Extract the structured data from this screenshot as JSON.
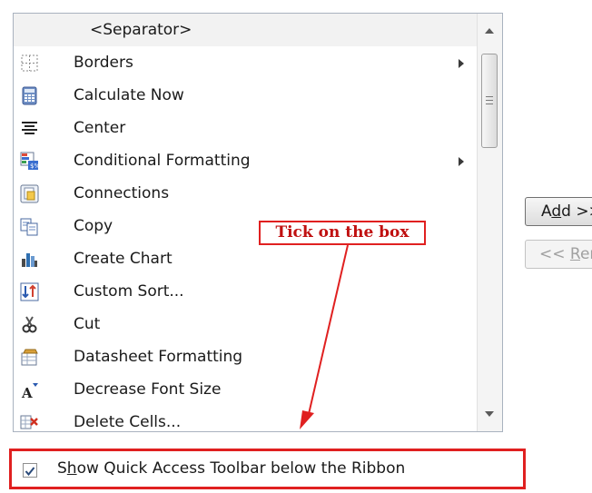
{
  "list": {
    "separator_label": "<Separator>",
    "items": [
      {
        "label": "Borders",
        "icon": "borders-icon",
        "submenu": true
      },
      {
        "label": "Calculate Now",
        "icon": "calculator-icon",
        "submenu": false
      },
      {
        "label": "Center",
        "icon": "align-center-icon",
        "submenu": false
      },
      {
        "label": "Conditional Formatting",
        "icon": "conditional-formatting-icon",
        "submenu": true
      },
      {
        "label": "Connections",
        "icon": "connections-icon",
        "submenu": false
      },
      {
        "label": "Copy",
        "icon": "copy-icon",
        "submenu": false
      },
      {
        "label": "Create Chart",
        "icon": "chart-icon",
        "submenu": false
      },
      {
        "label": "Custom Sort...",
        "icon": "sort-icon",
        "submenu": false
      },
      {
        "label": "Cut",
        "icon": "scissors-icon",
        "submenu": false
      },
      {
        "label": "Datasheet Formatting",
        "icon": "datasheet-formatting-icon",
        "submenu": false
      },
      {
        "label": "Decrease Font Size",
        "icon": "decrease-font-icon",
        "submenu": false
      },
      {
        "label": "Delete Cells...",
        "icon": "delete-cells-icon",
        "submenu": false
      }
    ]
  },
  "buttons": {
    "add_prefix": "A",
    "add_underline": "d",
    "add_rest": "d >>",
    "remove_prefix": "<< ",
    "remove_underline": "R",
    "remove_rest": "emove"
  },
  "annotation": {
    "text": "Tick on the box",
    "color": "#e02020"
  },
  "checkbox": {
    "label_prefix": "S",
    "label_underline": "h",
    "label_rest": "ow Quick Access Toolbar below the Ribbon",
    "checked": true
  }
}
